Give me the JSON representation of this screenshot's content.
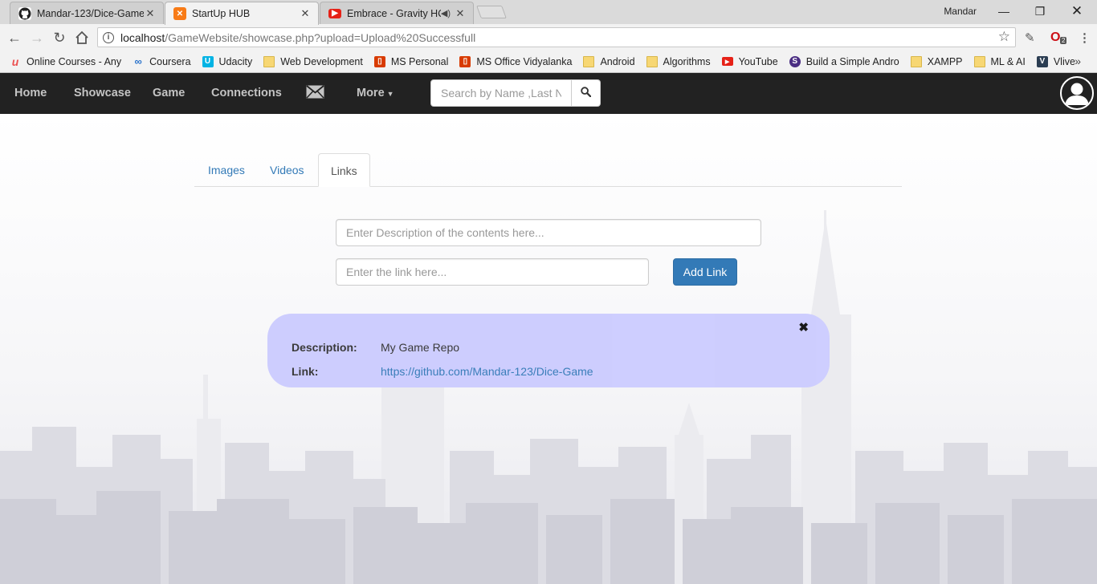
{
  "browser": {
    "tabs": [
      {
        "title": "Mandar-123/Dice-Game",
        "icon": "github-icon"
      },
      {
        "title": "StartUp HUB",
        "icon": "xampp-icon"
      },
      {
        "title": "Embrace - Gravity HQ",
        "icon": "youtube-icon"
      }
    ],
    "profile_name": "Mandar",
    "url_host": "localhost",
    "url_path": "/GameWebsite/showcase.php?upload=Upload%20Successfull",
    "opera_badge": "2",
    "bookmarks": [
      {
        "label": "Online Courses - Any",
        "icon": "udemy-icon",
        "color": "#ec5252"
      },
      {
        "label": "Coursera",
        "icon": "coursera-icon",
        "color": "#2a73cc"
      },
      {
        "label": "Udacity",
        "icon": "udacity-icon",
        "color": "#02b3e4"
      },
      {
        "label": "Web Development",
        "icon": "folder-icon"
      },
      {
        "label": "MS Personal",
        "icon": "office-icon",
        "color": "#d83b01"
      },
      {
        "label": "MS Office Vidyalanka",
        "icon": "office-icon",
        "color": "#d83b01"
      },
      {
        "label": "Android",
        "icon": "folder-icon"
      },
      {
        "label": "Algorithms",
        "icon": "folder-icon"
      },
      {
        "label": "YouTube",
        "icon": "youtube-icon",
        "color": "#e62117"
      },
      {
        "label": "Build a Simple Andro",
        "icon": "s-icon",
        "color": "#4b2e83"
      },
      {
        "label": "XAMPP",
        "icon": "folder-icon"
      },
      {
        "label": "ML & AI",
        "icon": "folder-icon"
      },
      {
        "label": "Vlive",
        "icon": "vlive-icon",
        "color": "#2b3d52"
      }
    ]
  },
  "navbar": {
    "home": "Home",
    "showcase": "Showcase",
    "game": "Game",
    "connections": "Connections",
    "more": "More",
    "search_placeholder": "Search by Name ,Last Name"
  },
  "showcase": {
    "tabs": [
      "Images",
      "Videos",
      "Links"
    ],
    "active_tab": "Links",
    "description_placeholder": "Enter Description of the contents here...",
    "link_placeholder": "Enter the link here...",
    "add_button": "Add Link",
    "entry": {
      "description_label": "Description:",
      "description_value": "My Game Repo",
      "link_label": "Link:",
      "link_value": "https://github.com/Mandar-123/Dice-Game"
    }
  },
  "colors": {
    "navbar_bg": "#222222",
    "primary": "#337ab7",
    "card_bg": "#ccccff"
  }
}
